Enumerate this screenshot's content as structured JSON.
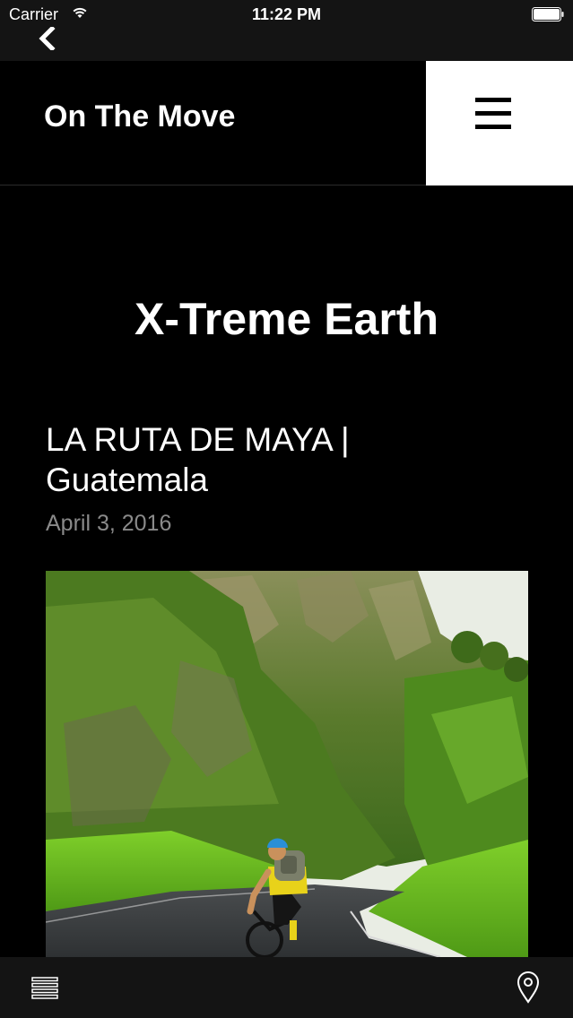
{
  "status_bar": {
    "carrier": "Carrier",
    "time": "11:22 PM"
  },
  "nav": {
    "back_icon": "chevron-left-icon"
  },
  "header": {
    "site_title": "On The Move",
    "menu_icon": "hamburger-menu-icon"
  },
  "main": {
    "blog_title": "X-Treme Earth",
    "post": {
      "title_line1": "LA RUTA DE MAYA |",
      "title_line2": "Guatemala",
      "date": "April 3, 2016",
      "image_icon": "cyclist-canyon-road-photo"
    }
  },
  "toolbar": {
    "list_icon": "list-icon",
    "location_icon": "location-pin-icon"
  },
  "colors": {
    "background": "#000000",
    "bar": "#141414",
    "date": "#8a8a8a",
    "menu_bg": "#ffffff"
  }
}
